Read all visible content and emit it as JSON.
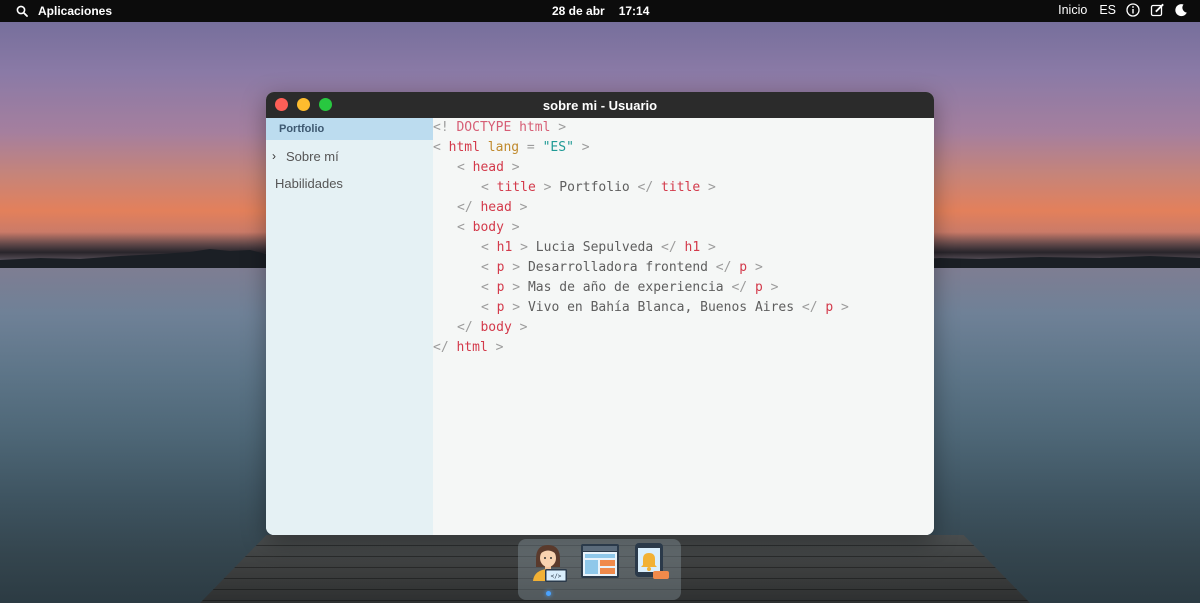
{
  "topbar": {
    "apps_label": "Aplicaciones",
    "date": "28 de abr",
    "time": "17:14",
    "home_label": "Inicio",
    "language": "ES",
    "icons": [
      "search-icon",
      "info-icon",
      "edit-icon",
      "dark-mode-icon"
    ]
  },
  "window": {
    "title": "sobre mi - Usuario"
  },
  "sidebar": {
    "header": "Portfolio",
    "items": [
      {
        "label": "Sobre mí",
        "expanded": true
      },
      {
        "label": "Habilidades"
      }
    ]
  },
  "editor": {
    "lines": [
      [
        "<!",
        " DOCTYPE html ",
        ">"
      ],
      [
        "< ",
        "html",
        " lang",
        " = ",
        "\"ES\"",
        " >"
      ],
      [
        "< ",
        "head",
        " >"
      ],
      [
        "< ",
        "title",
        " > ",
        "Portfolio",
        " </ ",
        "title",
        " >"
      ],
      [
        "</ ",
        "head",
        " >"
      ],
      [
        "< ",
        "body",
        " >"
      ],
      [
        "< ",
        "h1",
        " > ",
        "Lucia Sepulveda",
        " </ ",
        "h1",
        " >"
      ],
      [
        "< ",
        "p",
        " > ",
        "Desarrolladora frontend",
        " </ ",
        "p",
        " >"
      ],
      [
        "< ",
        "p",
        " > ",
        "Mas de año de experiencia",
        " </ ",
        "p",
        " >"
      ],
      [
        "< ",
        "p",
        " > ",
        "Vivo en Bahía Blanca, Buenos Aires",
        " </ ",
        "p",
        " >"
      ],
      [
        "</ ",
        "body",
        " >"
      ],
      [
        "</ ",
        "html",
        " >"
      ]
    ]
  },
  "dock": {
    "apps": [
      "developer-avatar-icon",
      "layout-editor-icon",
      "notification-app-icon"
    ]
  },
  "colors": {
    "tag": "#d33a4b",
    "attribute": "#c08a2d",
    "string": "#1f9a95",
    "punctuation": "#9c9c9c",
    "sidebar_header": "#bcdcef"
  }
}
